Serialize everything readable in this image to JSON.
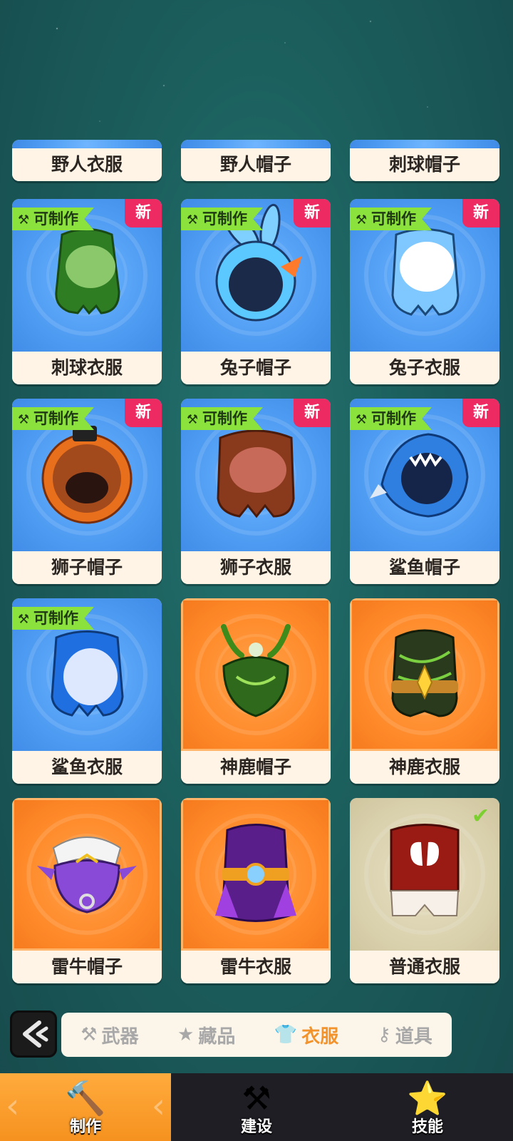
{
  "cards_partial": [
    {
      "label": "野人衣服"
    },
    {
      "label": "野人帽子"
    },
    {
      "label": "刺球帽子"
    }
  ],
  "cards": [
    {
      "label": "刺球衣服",
      "craft": "可制作",
      "badge": "新",
      "rarity": "blue",
      "icon": "green-suit-icon"
    },
    {
      "label": "兔子帽子",
      "craft": "可制作",
      "badge": "新",
      "rarity": "blue",
      "icon": "bunny-hat-icon"
    },
    {
      "label": "兔子衣服",
      "craft": "可制作",
      "badge": "新",
      "rarity": "blue",
      "icon": "light-blue-suit-icon"
    },
    {
      "label": "狮子帽子",
      "craft": "可制作",
      "badge": "新",
      "rarity": "blue",
      "icon": "lion-hat-icon"
    },
    {
      "label": "狮子衣服",
      "craft": "可制作",
      "badge": "新",
      "rarity": "blue",
      "icon": "brown-suit-icon"
    },
    {
      "label": "鲨鱼帽子",
      "craft": "可制作",
      "badge": "新",
      "rarity": "blue",
      "icon": "shark-hat-icon"
    },
    {
      "label": "鲨鱼衣服",
      "craft": "可制作",
      "badge": "",
      "rarity": "blue",
      "icon": "blue-suit-icon"
    },
    {
      "label": "神鹿帽子",
      "craft": "",
      "badge": "",
      "rarity": "orange",
      "icon": "deer-hat-icon"
    },
    {
      "label": "神鹿衣服",
      "craft": "",
      "badge": "",
      "rarity": "orange",
      "icon": "deer-suit-icon"
    },
    {
      "label": "雷牛帽子",
      "craft": "",
      "badge": "",
      "rarity": "orange",
      "icon": "bull-hat-icon"
    },
    {
      "label": "雷牛衣服",
      "craft": "",
      "badge": "",
      "rarity": "orange",
      "icon": "bull-suit-icon"
    },
    {
      "label": "普通衣服",
      "craft": "",
      "badge": "",
      "rarity": "beige",
      "icon": "red-suit-icon",
      "equipped": true
    }
  ],
  "category_tabs": [
    {
      "label": "武器",
      "icon": "hammer-icon",
      "active": false
    },
    {
      "label": "藏品",
      "icon": "star-icon",
      "active": false
    },
    {
      "label": "衣服",
      "icon": "shirt-icon",
      "active": true
    },
    {
      "label": "道具",
      "icon": "key-icon",
      "active": false
    }
  ],
  "bottom_nav": [
    {
      "label": "制作",
      "icon": "hammer-icon",
      "active": true
    },
    {
      "label": "建设",
      "icon": "build-hammer-icon",
      "active": false
    },
    {
      "label": "技能",
      "icon": "star-character-icon",
      "active": false
    }
  ],
  "colors": {
    "blue_card": "#4d9bf2",
    "orange_card": "#ff8a2a",
    "new_badge": "#ee2a63",
    "craft_tag": "#8be23c",
    "active_tab": "#f2932b",
    "nav_active": "#f6921f"
  }
}
